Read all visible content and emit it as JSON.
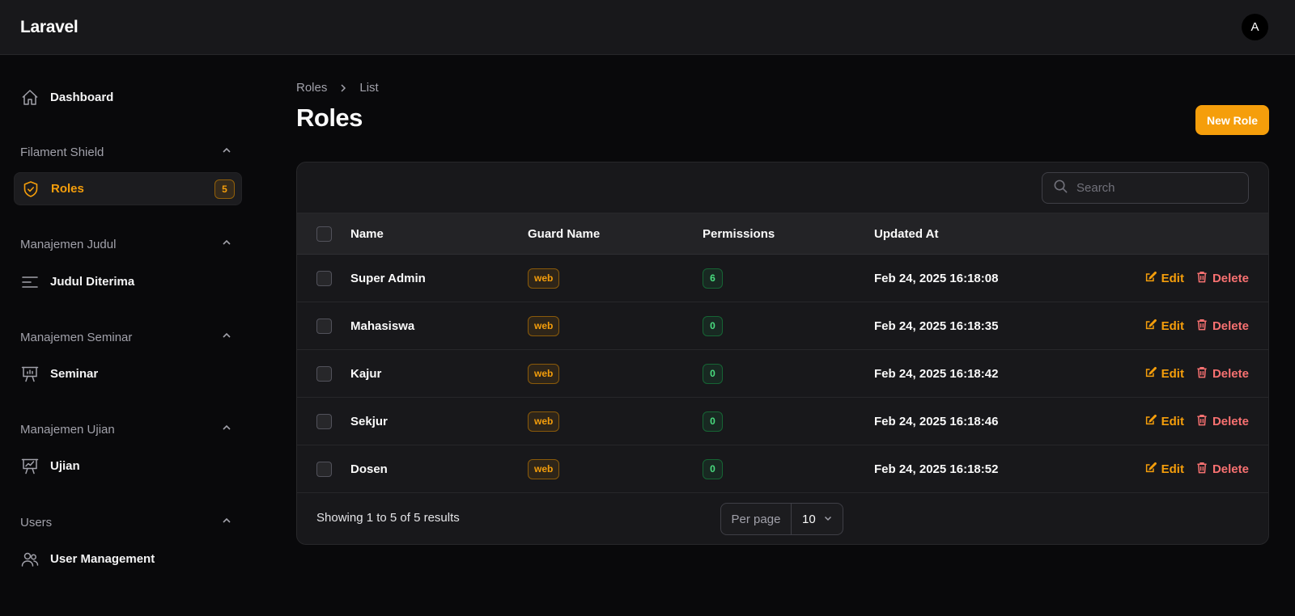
{
  "app": {
    "brand": "Laravel",
    "avatar_initial": "A"
  },
  "sidebar": {
    "dashboard": {
      "label": "Dashboard",
      "icon": "home-icon"
    },
    "groups": [
      {
        "label": "Filament Shield",
        "items": [
          {
            "label": "Roles",
            "icon": "shield-check-icon",
            "badge": "5",
            "active": true
          }
        ]
      },
      {
        "label": "Manajemen Judul",
        "items": [
          {
            "label": "Judul Diterima",
            "icon": "bars-left-icon"
          }
        ]
      },
      {
        "label": "Manajemen Seminar",
        "items": [
          {
            "label": "Seminar",
            "icon": "presentation-chart-bar-icon"
          }
        ]
      },
      {
        "label": "Manajemen Ujian",
        "items": [
          {
            "label": "Ujian",
            "icon": "presentation-chart-line-icon"
          }
        ]
      },
      {
        "label": "Users",
        "items": [
          {
            "label": "User Management",
            "icon": "users-icon"
          }
        ]
      }
    ]
  },
  "page": {
    "breadcrumb": [
      "Roles",
      "List"
    ],
    "title": "Roles",
    "new_button": "New Role"
  },
  "table": {
    "search_placeholder": "Search",
    "columns": {
      "name": "Name",
      "guard": "Guard Name",
      "permissions": "Permissions",
      "updated": "Updated At"
    },
    "rows": [
      {
        "name": "Super Admin",
        "guard": "web",
        "permissions": "6",
        "updated": "Feb 24, 2025 16:18:08"
      },
      {
        "name": "Mahasiswa",
        "guard": "web",
        "permissions": "0",
        "updated": "Feb 24, 2025 16:18:35"
      },
      {
        "name": "Kajur",
        "guard": "web",
        "permissions": "0",
        "updated": "Feb 24, 2025 16:18:42"
      },
      {
        "name": "Sekjur",
        "guard": "web",
        "permissions": "0",
        "updated": "Feb 24, 2025 16:18:46"
      },
      {
        "name": "Dosen",
        "guard": "web",
        "permissions": "0",
        "updated": "Feb 24, 2025 16:18:52"
      }
    ],
    "edit_label": "Edit",
    "delete_label": "Delete",
    "summary": "Showing 1 to 5 of 5 results",
    "per_page_label": "Per page",
    "per_page_value": "10"
  },
  "colors": {
    "accent": "#f59e0b",
    "danger": "#f87171",
    "success": "#4ade80",
    "background": "#09090b",
    "surface": "#18181b"
  }
}
